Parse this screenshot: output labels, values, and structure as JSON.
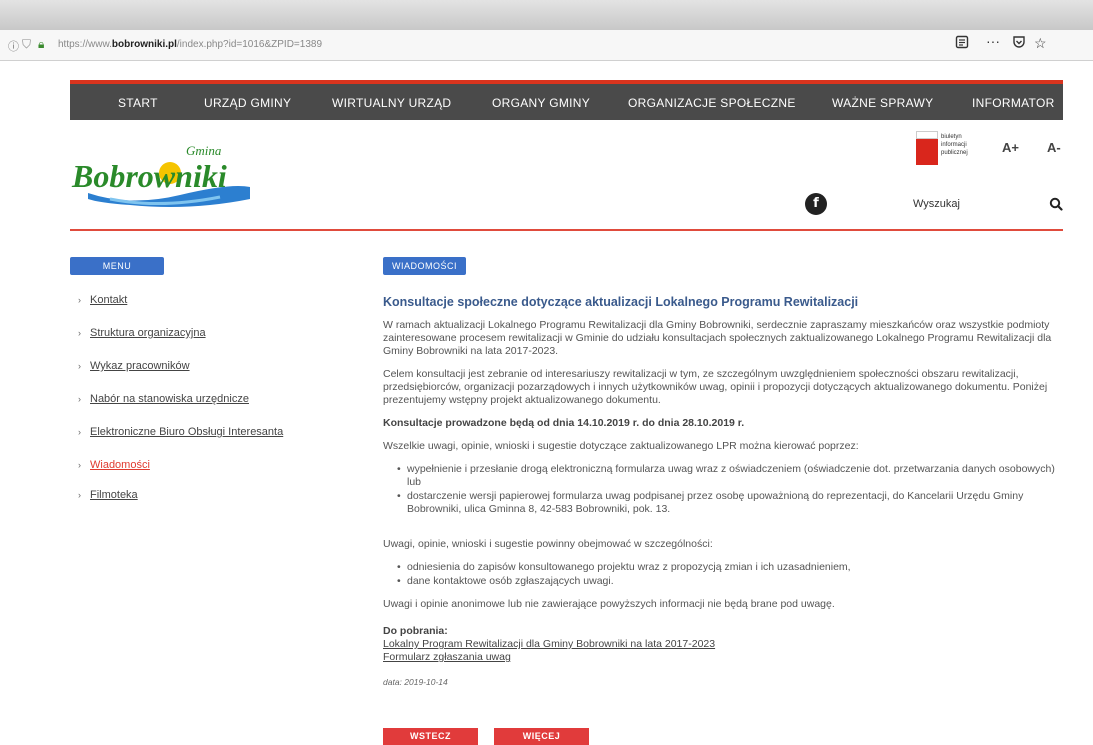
{
  "browser": {
    "url_prefix": "https://www.",
    "url_domain": "bobrowniki.pl",
    "url_rest": "/index.php?id=1016&ZPID=1389"
  },
  "nav": {
    "items": [
      "START",
      "URZĄD GMINY",
      "WIRTUALNY URZĄD",
      "ORGANY GMINY",
      "ORGANIZACJE SPOŁECZNE",
      "WAŻNE SPRAWY",
      "INFORMATOR"
    ]
  },
  "header": {
    "logo_script": "Gmina",
    "logo_name": "Bobrowniki",
    "bip_text": [
      "biuletyn",
      "informacji",
      "publicznej"
    ],
    "font_increase": "A+",
    "font_decrease": "A-",
    "facebook_glyph": "f",
    "search_label": "Wyszukaj"
  },
  "sidebar": {
    "header": "MENU",
    "items": [
      {
        "label": "Kontakt"
      },
      {
        "label": "Struktura organizacyjna"
      },
      {
        "label": "Wykaz pracowników"
      },
      {
        "label": "Nabór na stanowiska urzędnicze"
      },
      {
        "label": "Elektroniczne Biuro Obsługi Interesanta"
      },
      {
        "label": "Wiadomości"
      },
      {
        "label": "Filmoteka"
      }
    ]
  },
  "article": {
    "category": "WIADOMOŚCI",
    "title": "Konsultacje społeczne dotyczące aktualizacji Lokalnego Programu Rewitalizacji",
    "p1": "W ramach aktualizacji Lokalnego Programu Rewitalizacji dla Gminy Bobrowniki, serdecznie zapraszamy mieszkańców oraz wszystkie podmioty zainteresowane procesem rewitalizacji w Gminie do udziału konsultacjach społecznych zaktualizowanego Lokalnego Programu Rewitalizacji dla Gminy Bobrowniki na lata 2017-2023.",
    "p2": "Celem konsultacji jest zebranie od interesariuszy rewitalizacji w tym, ze szczególnym uwzględnieniem społeczności obszaru rewitalizacji, przedsiębiorców, organizacji pozarządowych i innych użytkowników uwag, opinii i propozycji dotyczących aktualizowanego dokumentu. Poniżej prezentujemy wstępny projekt aktualizowanego dokumentu.",
    "p3": "Konsultacje prowadzone będą od dnia 14.10.2019 r. do dnia 28.10.2019 r.",
    "p4": "Wszelkie uwagi, opinie, wnioski i sugestie dotyczące zaktualizowanego LPR można kierować poprzez:",
    "list1": [
      "wypełnienie i przesłanie drogą elektroniczną formularza uwag wraz z oświadczeniem (oświadczenie dot. przetwarzania danych osobowych) lub",
      "dostarczenie wersji papierowej formularza uwag podpisanej przez osobę upoważnioną do reprezentacji, do Kancelarii Urzędu Gminy Bobrowniki, ulica Gminna 8, 42-583 Bobrowniki, pok. 13."
    ],
    "p5": "Uwagi, opinie, wnioski i sugestie powinny obejmować w szczególności:",
    "list2": [
      "odniesienia do zapisów konsultowanego projektu wraz z propozycją zmian i ich uzasadnieniem,",
      "dane kontaktowe osób zgłaszających uwagi."
    ],
    "p6": "Uwagi i opinie anonimowe lub nie zawierające powyższych informacji nie będą brane pod uwagę.",
    "downloads_label": "Do pobrania:",
    "downloads": [
      "Lokalny Program Rewitalizacji dla Gminy Bobrowniki na lata 2017-2023",
      "Formularz zgłaszania uwag"
    ],
    "date": "data: 2019-10-14",
    "back_button": "WSTECZ",
    "more_button": "WIĘCEJ"
  },
  "colors": {
    "nav_bg": "#4a4a4a",
    "accent_red": "#e04b3c",
    "tag_blue": "#3a70c8",
    "title_blue": "#3a5a8c"
  }
}
